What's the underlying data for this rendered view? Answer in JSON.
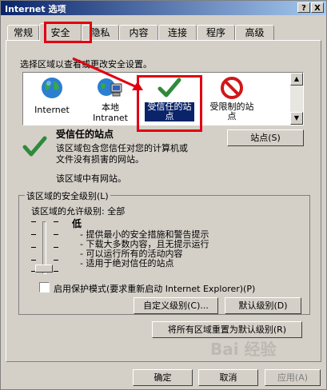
{
  "window": {
    "title": "Internet 选项",
    "help_label": "?",
    "close_label": "X"
  },
  "tabs": [
    {
      "label": "常规"
    },
    {
      "label": "安全"
    },
    {
      "label": "隐私"
    },
    {
      "label": "内容"
    },
    {
      "label": "连接"
    },
    {
      "label": "程序"
    },
    {
      "label": "高级"
    }
  ],
  "security": {
    "select_zone_text": "选择区域以查看或更改安全设置。",
    "zones": [
      {
        "label": "Internet",
        "icon": "globe-icon"
      },
      {
        "label": "本地\nIntranet",
        "icon": "intranet-icon"
      },
      {
        "label": "受信任的站点",
        "icon": "checkmark-icon",
        "selected": true
      },
      {
        "label": "受限制的站点",
        "icon": "restricted-icon"
      }
    ],
    "zone_title": "受信任的站点",
    "zone_desc": "该区域包含您信任对您的计算机或\n文件没有损害的网站。",
    "zone_has_sites": "该区域中有网站。",
    "sites_button": "站点(S)",
    "level_group_label": "该区域的安全级别(L)",
    "allowed_levels": "该区域的允许级别: 全部",
    "level_name": "低",
    "level_bullets": [
      "- 提供最小的安全措施和警告提示",
      "- 下载大多数内容，且无提示运行",
      "- 可以运行所有的活动内容",
      "- 适用于绝对信任的站点"
    ],
    "slider_level": 0.0,
    "protected_mode_label": "启用保护模式(要求重新启动 Internet Explorer)(P)",
    "protected_mode_checked": false,
    "custom_level_button": "自定义级别(C)...",
    "default_level_button": "默认级别(D)",
    "reset_all_button": "将所有区域重置为默认级别(R)"
  },
  "footer": {
    "ok": "确定",
    "cancel": "取消",
    "apply": "应用(A)"
  },
  "watermark": "Bai 经验",
  "colors": {
    "highlight_red": "#e00010",
    "selection_blue": "#0a246a",
    "title_blue": "#0a246a"
  }
}
